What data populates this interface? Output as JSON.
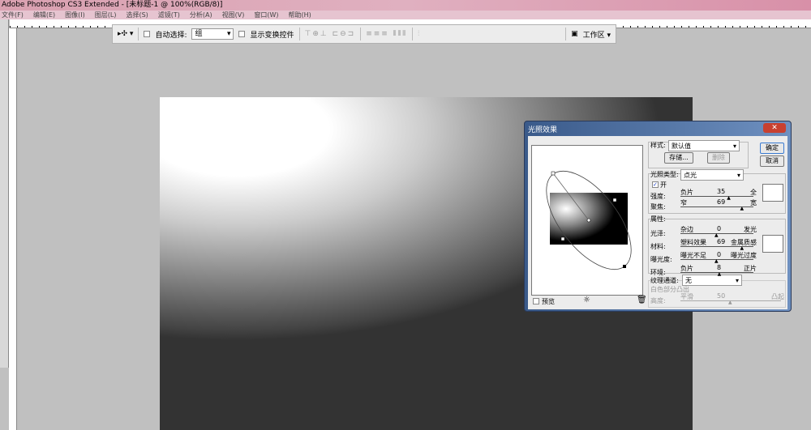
{
  "window": {
    "title": "Adobe Photoshop CS3 Extended - [未标题-1 @ 100%(RGB/8)]"
  },
  "menu": [
    "文件(F)",
    "编辑(E)",
    "图像(I)",
    "图层(L)",
    "选择(S)",
    "滤镜(T)",
    "分析(A)",
    "视图(V)",
    "窗口(W)",
    "帮助(H)"
  ],
  "options": {
    "auto_select_label": "自动选择:",
    "auto_select_value": "组",
    "show_transform_label": "显示变换控件",
    "workspace_label": "工作区 ▾",
    "align_icons": "⊤⊕⊥ ⊏⊖⊐",
    "distribute_icons": "≡≡≡ ⫴⫴⫴",
    "auto_align_icon": "⫶"
  },
  "dialog": {
    "title": "光照效果",
    "close": "✕",
    "ok": "确定",
    "cancel": "取消",
    "style_label": "样式:",
    "style_value": "默认值",
    "save": "存储...",
    "delete": "删除",
    "light_type_label": "光照类型:",
    "light_type_value": "点光",
    "on_label": "开",
    "intensity": {
      "label": "强度:",
      "left": "负片",
      "value": "35",
      "right": "全",
      "fraction": 0.67
    },
    "focus": {
      "label": "聚焦:",
      "left": "窄",
      "value": "69",
      "right": "宽",
      "fraction": 0.85
    },
    "properties_label": "属性:",
    "gloss": {
      "label": "光泽:",
      "left": "杂边",
      "value": "0",
      "right": "发光",
      "fraction": 0.5
    },
    "material": {
      "label": "材料:",
      "left": "塑料效果",
      "value": "69",
      "right": "金属质感",
      "fraction": 0.85
    },
    "exposure": {
      "label": "曝光度:",
      "left": "曝光不足",
      "value": "0",
      "right": "曝光过度",
      "fraction": 0.5
    },
    "ambience": {
      "label": "环境:",
      "left": "负片",
      "value": "8",
      "right": "正片",
      "fraction": 0.54
    },
    "texture_label": "纹理通道:",
    "texture_value": "无",
    "white_high": "白色部分凸出",
    "height": {
      "label": "高度:",
      "left": "平滑",
      "value": "50",
      "right": "凸起",
      "fraction": 0.5
    },
    "preview_label": "预览"
  }
}
